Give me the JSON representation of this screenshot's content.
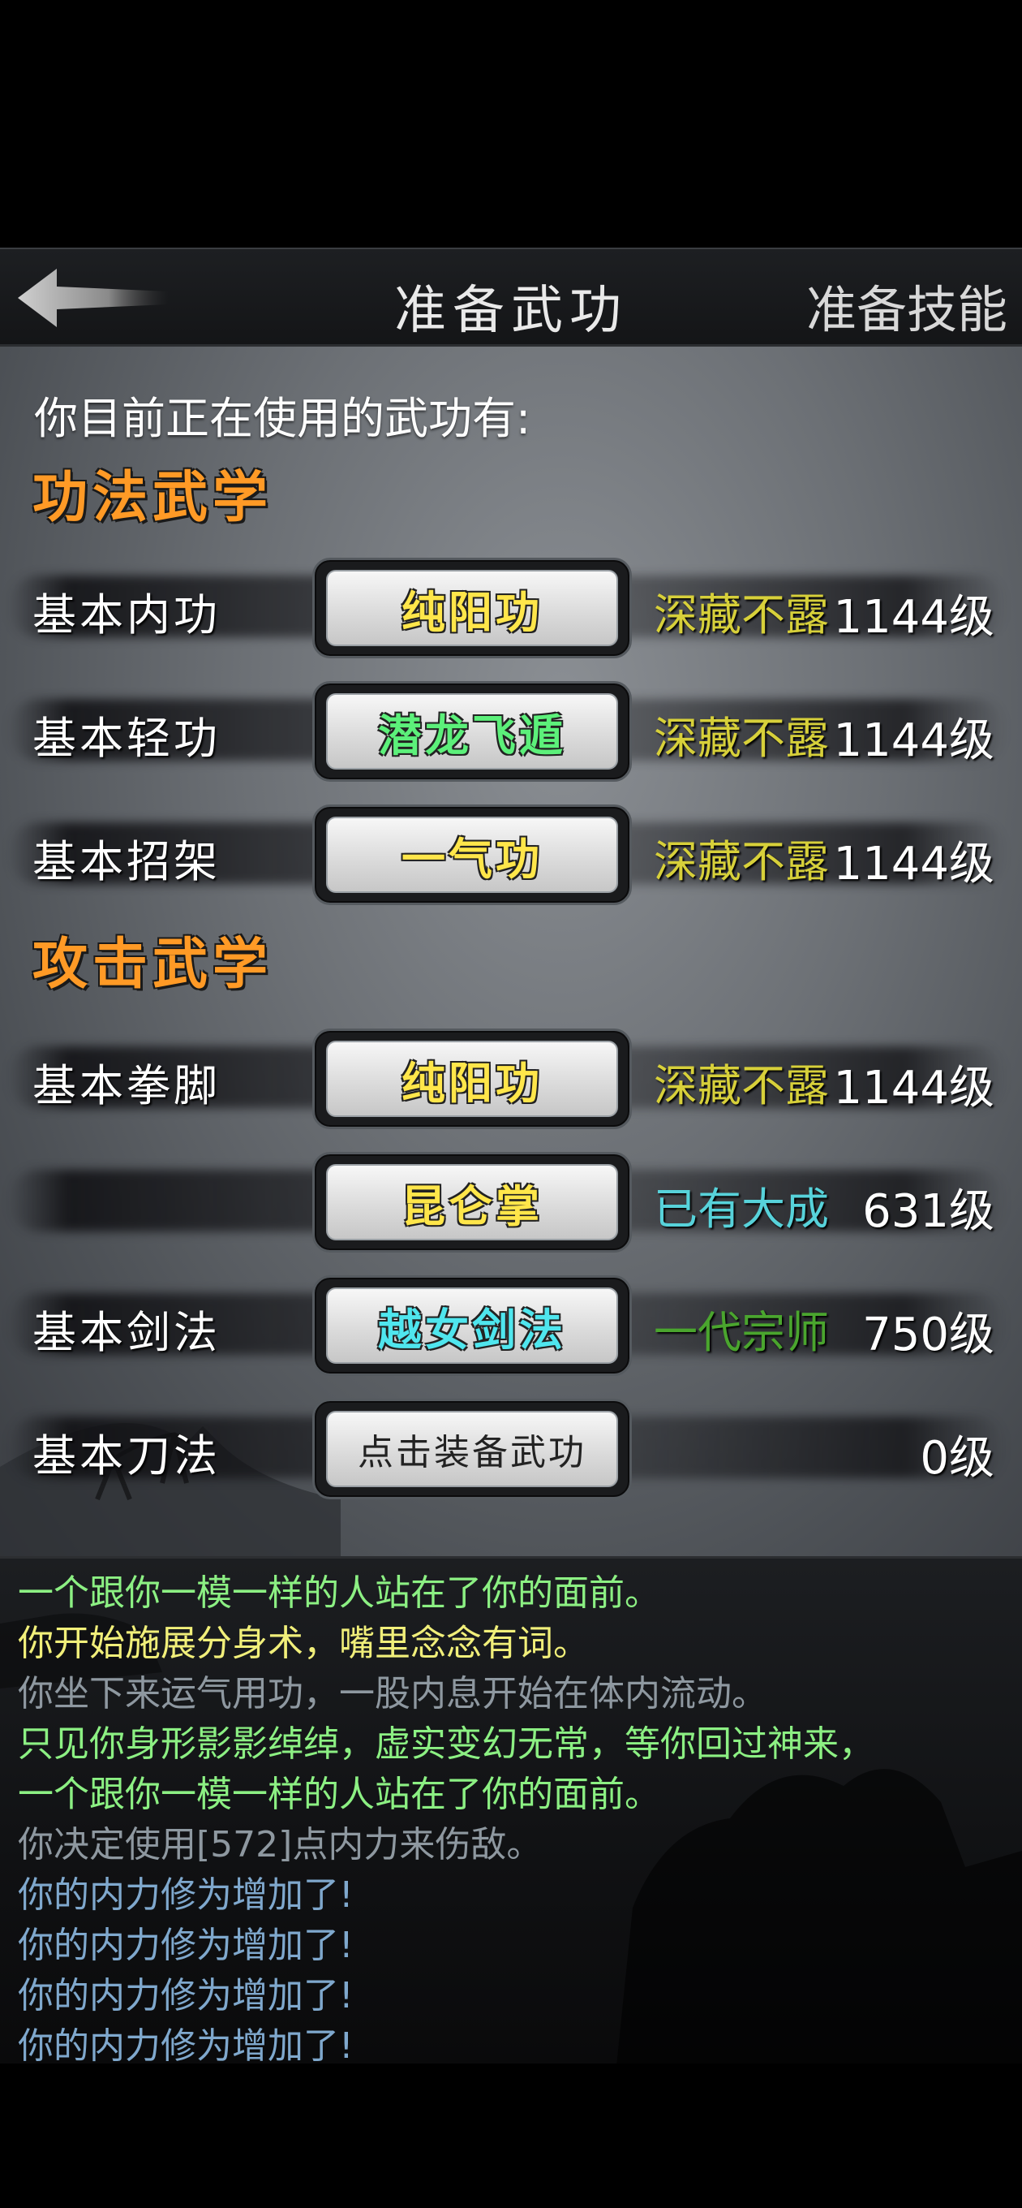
{
  "header": {
    "title": "准备武功",
    "skills_button": "准备技能"
  },
  "intro_text": "你目前正在使用的武功有:",
  "sections": [
    {
      "title": "功法武学",
      "rows": [
        {
          "category": "基本内功",
          "skill": "纯阳功",
          "skill_color": "yellow",
          "rank": "深藏不露",
          "rank_color": "y",
          "level": "1144级"
        },
        {
          "category": "基本轻功",
          "skill": "潜龙飞遁",
          "skill_color": "green",
          "rank": "深藏不露",
          "rank_color": "y",
          "level": "1144级"
        },
        {
          "category": "基本招架",
          "skill": "一气功",
          "skill_color": "yellow",
          "rank": "深藏不露",
          "rank_color": "y",
          "level": "1144级"
        }
      ]
    },
    {
      "title": "攻击武学",
      "rows": [
        {
          "category": "基本拳脚",
          "skill": "纯阳功",
          "skill_color": "yellow",
          "rank": "深藏不露",
          "rank_color": "y",
          "level": "1144级"
        },
        {
          "category": "",
          "skill": "昆仑掌",
          "skill_color": "yellow",
          "rank": "已有大成",
          "rank_color": "c",
          "level": "631级"
        },
        {
          "category": "基本剑法",
          "skill": "越女剑法",
          "skill_color": "cyan",
          "rank": "一代宗师",
          "rank_color": "g",
          "level": "750级"
        },
        {
          "category": "基本刀法",
          "skill": "点击装备武功",
          "skill_color": "empty",
          "rank": "",
          "rank_color": "y",
          "level": "0级"
        }
      ]
    }
  ],
  "log": [
    {
      "text": "一个跟你一模一样的人站在了你的面前。",
      "color": "green"
    },
    {
      "text": "你开始施展分身术，嘴里念念有词。",
      "color": "yellow"
    },
    {
      "text": "你坐下来运气用功，一股内息开始在体内流动。",
      "color": "gray"
    },
    {
      "text": "只见你身形影影绰绰，虚实变幻无常，等你回过神来，",
      "color": "green"
    },
    {
      "text": "一个跟你一模一样的人站在了你的面前。",
      "color": "green"
    },
    {
      "text": "你决定使用[572]点内力来伤敌。",
      "color": "gray"
    },
    {
      "text": "你的内力修为增加了!",
      "color": "cyan"
    },
    {
      "text": "你的内力修为增加了!",
      "color": "cyan"
    },
    {
      "text": "你的内力修为增加了!",
      "color": "cyan"
    },
    {
      "text": "你的内力修为增加了!",
      "color": "cyan"
    }
  ]
}
